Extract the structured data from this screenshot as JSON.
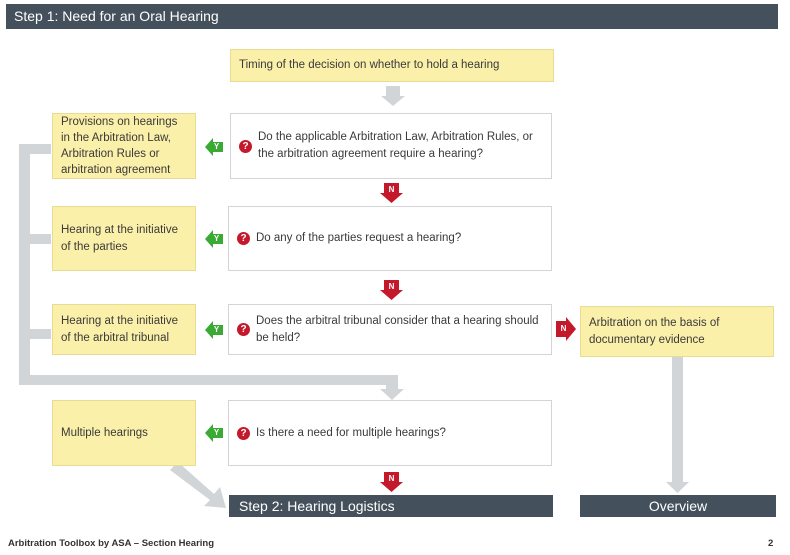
{
  "header": {
    "title": "Step 1: Need for an Oral Hearing"
  },
  "top_box": "Timing of the decision on whether to hold a hearing",
  "questions": [
    "Do the applicable Arbitration Law, Arbitration Rules, or the arbitration agreement require a hearing?",
    "Do any of the parties request a hearing?",
    "Does the arbitral tribunal consider that a hearing should be held?",
    "Is there a need for multiple hearings?"
  ],
  "outcomes": [
    "Provisions on hearings in the Arbitration Law, Arbitration Rules or arbitration agreement",
    "Hearing at the initiative of the parties",
    "Hearing at the initiative of the arbitral tribunal",
    "Multiple hearings"
  ],
  "no_outcome": "Arbitration on the basis of documentary evidence",
  "next_step": "Step 2: Hearing Logistics",
  "overview": "Overview",
  "labels": {
    "yes": "Y",
    "no": "N",
    "question": "?"
  },
  "footer": {
    "source": "Arbitration Toolbox by ASA – Section Hearing",
    "page": "2"
  },
  "colors": {
    "yes_green": "#3aaa35",
    "no_red": "#c4182b",
    "box_yellow": "#fbf0a9",
    "dark_bar": "#44505b",
    "connector_gray": "#d2d5d8"
  }
}
